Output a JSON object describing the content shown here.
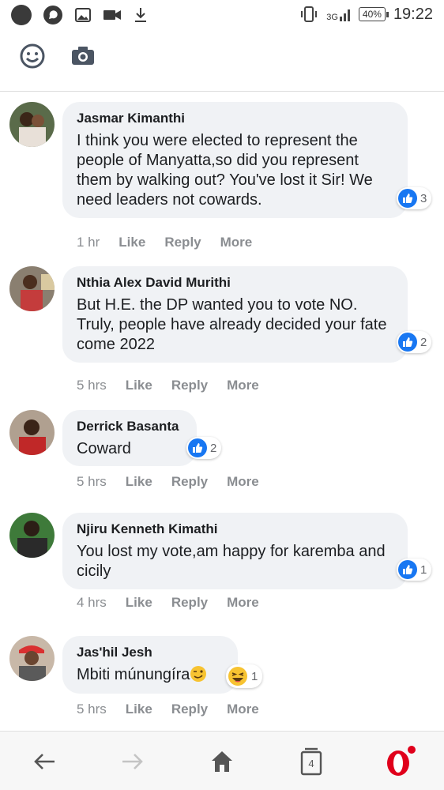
{
  "status_bar": {
    "time": "19:22",
    "battery": "40%",
    "network": "3G"
  },
  "comments": [
    {
      "author": "Jasmar Kimanthi",
      "text": "I think you were elected to represent the people of Manyatta,so did you represent them by walking out? You've lost it Sir! We need leaders not cowards.",
      "reaction_count": "3",
      "time": "1 hr",
      "like": "Like",
      "reply": "Reply",
      "more": "More"
    },
    {
      "author": "Nthia Alex David Murithi",
      "text": "But H.E. the DP wanted you to vote NO. Truly, people have already decided your fate come 2022",
      "reaction_count": "2",
      "time": "5 hrs",
      "like": "Like",
      "reply": "Reply",
      "more": "More"
    },
    {
      "author": "Derrick Basanta",
      "text": "Coward",
      "reaction_count": "2",
      "time": "5 hrs",
      "like": "Like",
      "reply": "Reply",
      "more": "More"
    },
    {
      "author": "Njiru Kenneth Kimathi",
      "text": "You lost my vote,am happy for karemba and cicily",
      "reaction_count": "1",
      "time": "4 hrs",
      "like": "Like",
      "reply": "Reply",
      "more": "More"
    },
    {
      "author": "Jas'hil Jesh",
      "text": "Mbiti múnungíra",
      "reaction_count": "1",
      "time": "5 hrs",
      "like": "Like",
      "reply": "Reply",
      "more": "More"
    }
  ],
  "bottom_nav": {
    "tabs_count": "4"
  },
  "colors": {
    "accent": "#1877f2",
    "bubble": "#f0f2f5",
    "opera_red": "#e0001b"
  }
}
